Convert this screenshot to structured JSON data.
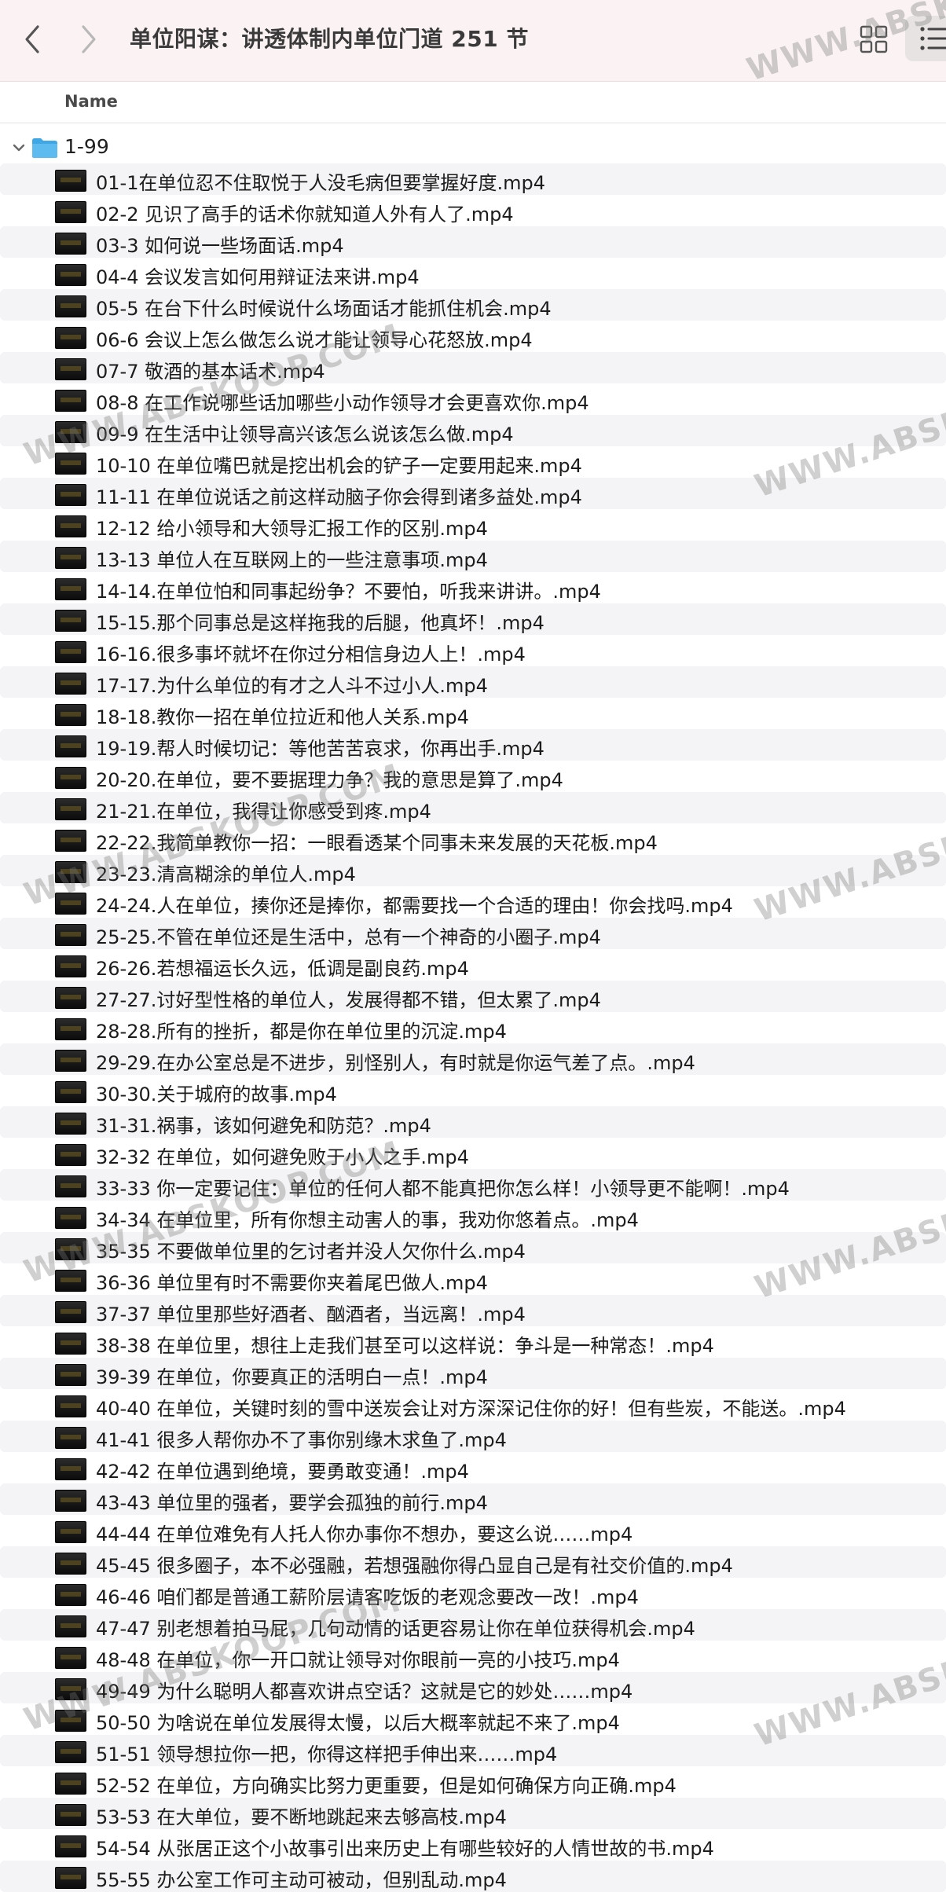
{
  "toolbar": {
    "title": "单位阳谋：讲透体制内单位门道 251 节",
    "back_icon": "chevron-left-icon",
    "forward_icon": "chevron-right-icon",
    "grid_view_icon": "grid-view-icon",
    "list_view_icon": "list-view-icon"
  },
  "columns": {
    "name": "Name"
  },
  "folder": {
    "label": "1-99",
    "expanded": true,
    "icon": "folder-icon",
    "color": "#3fa7e6"
  },
  "files": [
    "01-1在单位忍不住取悦于人没毛病但要掌握好度.mp4",
    "02-2 见识了高手的话术你就知道人外有人了.mp4",
    "03-3 如何说一些场面话.mp4",
    "04-4 会议发言如何用辩证法来讲.mp4",
    "05-5 在台下什么时候说什么场面话才能抓住机会.mp4",
    "06-6 会议上怎么做怎么说才能让领导心花怒放.mp4",
    "07-7 敬酒的基本话术.mp4",
    "08-8 在工作说哪些话加哪些小动作领导才会更喜欢你.mp4",
    "09-9 在生活中让领导高兴该怎么说该怎么做.mp4",
    "10-10 在单位嘴巴就是挖出机会的铲子一定要用起来.mp4",
    "11-11 在单位说话之前这样动脑子你会得到诸多益处.mp4",
    "12-12 给小领导和大领导汇报工作的区别.mp4",
    "13-13 单位人在互联网上的一些注意事项.mp4",
    "14-14.在单位怕和同事起纷争？不要怕，听我来讲讲。.mp4",
    "15-15.那个同事总是这样拖我的后腿，他真坏！.mp4",
    "16-16.很多事坏就坏在你过分相信身边人上！.mp4",
    "17-17.为什么单位的有才之人斗不过小人.mp4",
    "18-18.教你一招在单位拉近和他人关系.mp4",
    "19-19.帮人时候切记：等他苦苦哀求，你再出手.mp4",
    "20-20.在单位，要不要据理力争？我的意思是算了.mp4",
    "21-21.在单位，我得让你感受到疼.mp4",
    "22-22.我简单教你一招：一眼看透某个同事未来发展的天花板.mp4",
    "23-23.清高糊涂的单位人.mp4",
    "24-24.人在单位，揍你还是捧你，都需要找一个合适的理由！你会找吗.mp4",
    "25-25.不管在单位还是生活中，总有一个神奇的小圈子.mp4",
    "26-26.若想福运长久远，低调是副良药.mp4",
    "27-27.讨好型性格的单位人，发展得都不错，但太累了.mp4",
    "28-28.所有的挫折，都是你在单位里的沉淀.mp4",
    "29-29.在办公室总是不进步，别怪别人，有时就是你运气差了点。.mp4",
    "30-30.关于城府的故事.mp4",
    "31-31.祸事，该如何避免和防范？.mp4",
    "32-32 在单位，如何避免败于小人之手.mp4",
    "33-33 你一定要记住：单位的任何人都不能真把你怎么样！小领导更不能啊！.mp4",
    "34-34 在单位里，所有你想主动害人的事，我劝你悠着点。.mp4",
    "35-35 不要做单位里的乞讨者并没人欠你什么.mp4",
    "36-36 单位里有时不需要你夹着尾巴做人.mp4",
    "37-37 单位里那些好酒者、酗酒者，当远离！.mp4",
    "38-38 在单位里，想往上走我们甚至可以这样说：争斗是一种常态！.mp4",
    "39-39 在单位，你要真正的活明白一点！.mp4",
    "40-40 在单位，关键时刻的雪中送炭会让对方深深记住你的好！但有些炭，不能送。.mp4",
    "41-41 很多人帮你办不了事你别缘木求鱼了.mp4",
    "42-42 在单位遇到绝境，要勇敢变通！.mp4",
    "43-43 单位里的强者，要学会孤独的前行.mp4",
    "44-44 在单位难免有人托人你办事你不想办，要这么说……mp4",
    "45-45 很多圈子，本不必强融，若想强融你得凸显自己是有社交价值的.mp4",
    "46-46 咱们都是普通工薪阶层请客吃饭的老观念要改一改！.mp4",
    "47-47 别老想着拍马屁，几句动情的话更容易让你在单位获得机会.mp4",
    "48-48 在单位，你一开口就让领导对你眼前一亮的小技巧.mp4",
    "49-49 为什么聪明人都喜欢讲点空话？这就是它的妙处……mp4",
    "50-50 为啥说在单位发展得太慢，以后大概率就起不来了.mp4",
    "51-51 领导想拉你一把，你得这样把手伸出来……mp4",
    "52-52 在单位，方向确实比努力更重要，但是如何确保方向正确.mp4",
    "53-53 在大单位，要不断地跳起来去够高枝.mp4",
    "54-54 从张居正这个小故事引出来历史上有哪些较好的人情世故的书.mp4",
    "55-55 办公室工作可主动可被动，但别乱动.mp4"
  ],
  "watermarks": [
    "WWW.ABSKOOP.COM",
    "WWW.ABSKOOP.COM",
    "WWW.ABSKOOP.COM",
    "WWW.ABSKOOP.COM",
    "WWW.ABSKOOP.COM",
    "WWW.ABSKOOP.COM",
    "WWW.ABSKOOP.COM",
    "WWW.ABSKOOP.COM",
    "WWW.ABSKOOP.COM"
  ]
}
